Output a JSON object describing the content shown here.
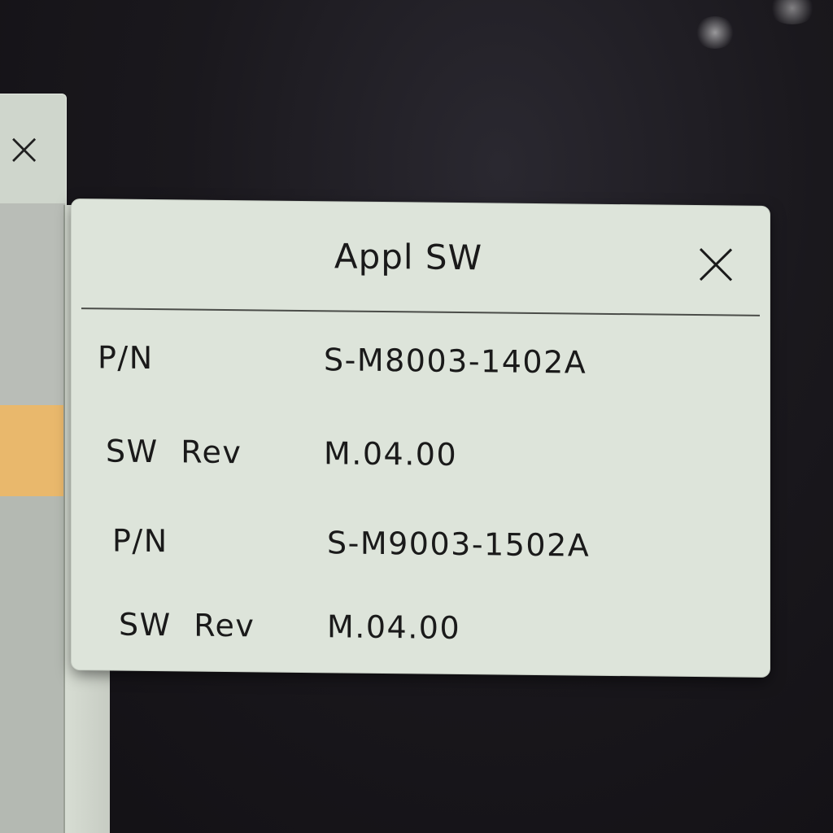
{
  "dialog": {
    "title": "Appl SW",
    "rows": [
      {
        "label": "P/N",
        "value": "S-M8003-1402A"
      },
      {
        "label": "SW Rev",
        "value": "M.04.00"
      },
      {
        "label": "P/N",
        "value": "S-M9003-1502A"
      },
      {
        "label": "SW Rev",
        "value": "M.04.00"
      }
    ]
  },
  "icons": {
    "close": "close-icon",
    "background_close": "close-icon"
  },
  "colors": {
    "dialog_bg": "#dde4da",
    "highlight": "#e9b86c",
    "text": "#1a1a1a",
    "screen_bg": "#1a181d"
  }
}
